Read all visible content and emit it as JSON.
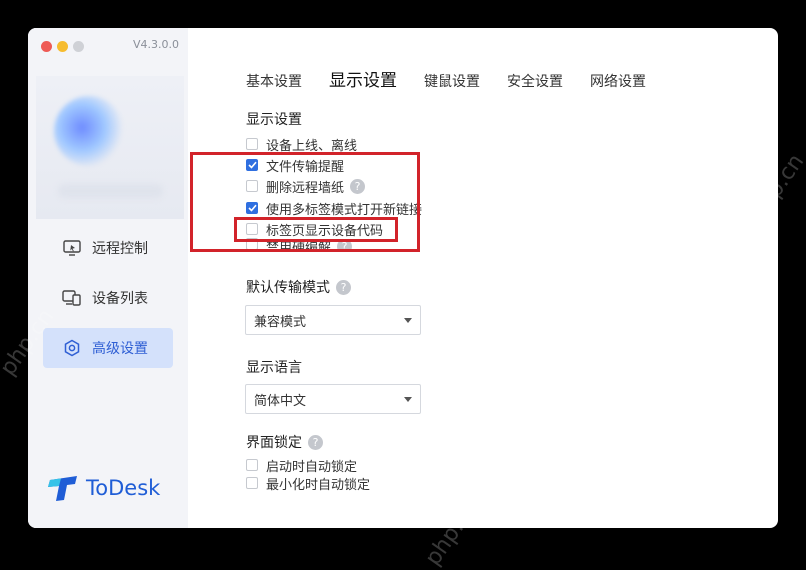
{
  "window": {
    "version": "V4.3.0.0",
    "traffic_colors": [
      "#ee5a55",
      "#f6bc2f",
      "#cfd1d6"
    ]
  },
  "sidebar": {
    "items": [
      {
        "label": "远程控制",
        "icon": "monitor-icon"
      },
      {
        "label": "设备列表",
        "icon": "devices-icon"
      },
      {
        "label": "高级设置",
        "icon": "settings-icon",
        "active": true
      }
    ],
    "logo_text": "ToDesk"
  },
  "tabs": [
    {
      "label": "基本设置"
    },
    {
      "label": "显示设置",
      "active": true
    },
    {
      "label": "键鼠设置"
    },
    {
      "label": "安全设置"
    },
    {
      "label": "网络设置"
    }
  ],
  "display_section": {
    "title": "显示设置",
    "options": [
      {
        "label": "设备上线、离线",
        "checked": false
      },
      {
        "label": "文件传输提醒",
        "checked": true
      },
      {
        "label": "删除远程墙纸",
        "checked": false,
        "help": "?"
      },
      {
        "label": "使用多标签模式打开新链接",
        "checked": true
      },
      {
        "label": "标签页显示设备代码",
        "checked": false
      },
      {
        "label": "禁用硬编解",
        "checked": false,
        "help": "?"
      }
    ]
  },
  "transfer_mode": {
    "title": "默认传输模式",
    "help": "?",
    "selected": "兼容模式"
  },
  "language": {
    "title": "显示语言",
    "selected": "简体中文"
  },
  "ui_lock": {
    "title": "界面锁定",
    "help": "?",
    "options": [
      {
        "label": "启动时自动锁定",
        "checked": false
      },
      {
        "label": "最小化时自动锁定",
        "checked": false
      }
    ]
  },
  "colors": {
    "accent": "#2f6fe0",
    "active_nav_bg": "#d4e1fb",
    "highlight": "#d2232a"
  },
  "watermark": "php.cn"
}
